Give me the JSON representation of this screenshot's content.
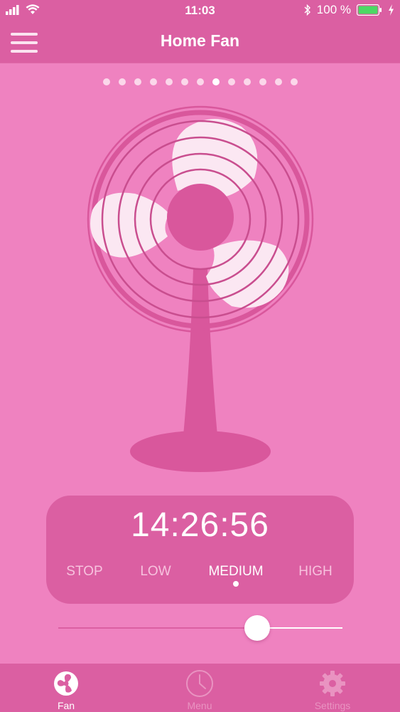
{
  "status_bar": {
    "time": "11:03",
    "battery_percent": "100 %",
    "icons": [
      "signal-icon",
      "wifi-icon",
      "bluetooth-icon",
      "battery-icon",
      "charging-icon"
    ]
  },
  "nav": {
    "title": "Home Fan",
    "menu_icon": "hamburger-menu-icon"
  },
  "pager": {
    "count": 13,
    "active_index": 7
  },
  "timer": {
    "display": "14:26:56"
  },
  "speed": {
    "options": [
      "STOP",
      "LOW",
      "MEDIUM",
      "HIGH"
    ],
    "selected": "MEDIUM"
  },
  "slider": {
    "value": 0.7
  },
  "tabs": [
    {
      "label": "Fan",
      "icon": "fan-icon",
      "active": true
    },
    {
      "label": "Menu",
      "icon": "clock-icon",
      "active": false
    },
    {
      "label": "Settings",
      "icon": "gear-icon",
      "active": false
    }
  ],
  "colors": {
    "background": "#ef82c0",
    "bar": "#db5fa2",
    "fan_dark": "#d9579c",
    "blade": "#fbe7f2"
  }
}
